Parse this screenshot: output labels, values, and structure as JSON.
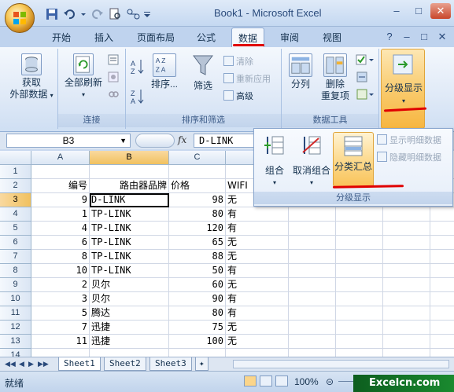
{
  "window": {
    "title": "Book1 - Microsoft Excel"
  },
  "tabs": [
    "开始",
    "插入",
    "页面布局",
    "公式",
    "数据",
    "审阅",
    "视图"
  ],
  "active_tab": "数据",
  "ribbon": {
    "get_external": {
      "line1": "获取",
      "line2": "外部数据"
    },
    "connections": {
      "refresh_all": "全部刷新",
      "group_label": "连接"
    },
    "sort_filter": {
      "sort": "排序...",
      "filter": "筛选",
      "clear": "清除",
      "reapply": "重新应用",
      "advanced": "高级",
      "group_label": "排序和筛选"
    },
    "data_tools": {
      "split": "分列",
      "remove_dup_1": "删除",
      "remove_dup_2": "重复项",
      "group_label": "数据工具"
    },
    "outline": {
      "label": "分级显示"
    }
  },
  "outline_panel": {
    "group": "组合",
    "ungroup": "取消组合",
    "subtotal": "分类汇总",
    "show_detail": "显示明细数据",
    "hide_detail": "隐藏明细数据",
    "group_label": "分级显示"
  },
  "formula_bar": {
    "name_box": "B3",
    "fx": "fx",
    "formula": "D-LINK"
  },
  "columns": [
    "A",
    "B",
    "C",
    "D"
  ],
  "rows": [
    {
      "n": "1",
      "a": "",
      "b": "",
      "c": "",
      "d": ""
    },
    {
      "n": "2",
      "a": "编号",
      "b": "路由器品牌",
      "c": "价格",
      "d": "WIFI"
    },
    {
      "n": "3",
      "a": "9",
      "b": "D-LINK",
      "c": "98",
      "d": "无"
    },
    {
      "n": "4",
      "a": "1",
      "b": "TP-LINK",
      "c": "80",
      "d": "有"
    },
    {
      "n": "5",
      "a": "4",
      "b": "TP-LINK",
      "c": "120",
      "d": "有"
    },
    {
      "n": "6",
      "a": "6",
      "b": "TP-LINK",
      "c": "65",
      "d": "无"
    },
    {
      "n": "7",
      "a": "8",
      "b": "TP-LINK",
      "c": "88",
      "d": "无"
    },
    {
      "n": "8",
      "a": "10",
      "b": "TP-LINK",
      "c": "50",
      "d": "有"
    },
    {
      "n": "9",
      "a": "2",
      "b": "贝尔",
      "c": "60",
      "d": "无"
    },
    {
      "n": "10",
      "a": "3",
      "b": "贝尔",
      "c": "90",
      "d": "有"
    },
    {
      "n": "11",
      "a": "5",
      "b": "腾达",
      "c": "80",
      "d": "有"
    },
    {
      "n": "12",
      "a": "7",
      "b": "迅捷",
      "c": "75",
      "d": "无"
    },
    {
      "n": "13",
      "a": "11",
      "b": "迅捷",
      "c": "100",
      "d": "无"
    },
    {
      "n": "14",
      "a": "",
      "b": "",
      "c": "",
      "d": ""
    }
  ],
  "sheets": [
    "Sheet1",
    "Sheet2",
    "Sheet3"
  ],
  "status": {
    "text": "就绪",
    "zoom": "100%"
  },
  "watermark": "Excelcn.com",
  "colors": {
    "accent_red": "#e00000",
    "selection": "#f1c15f"
  }
}
